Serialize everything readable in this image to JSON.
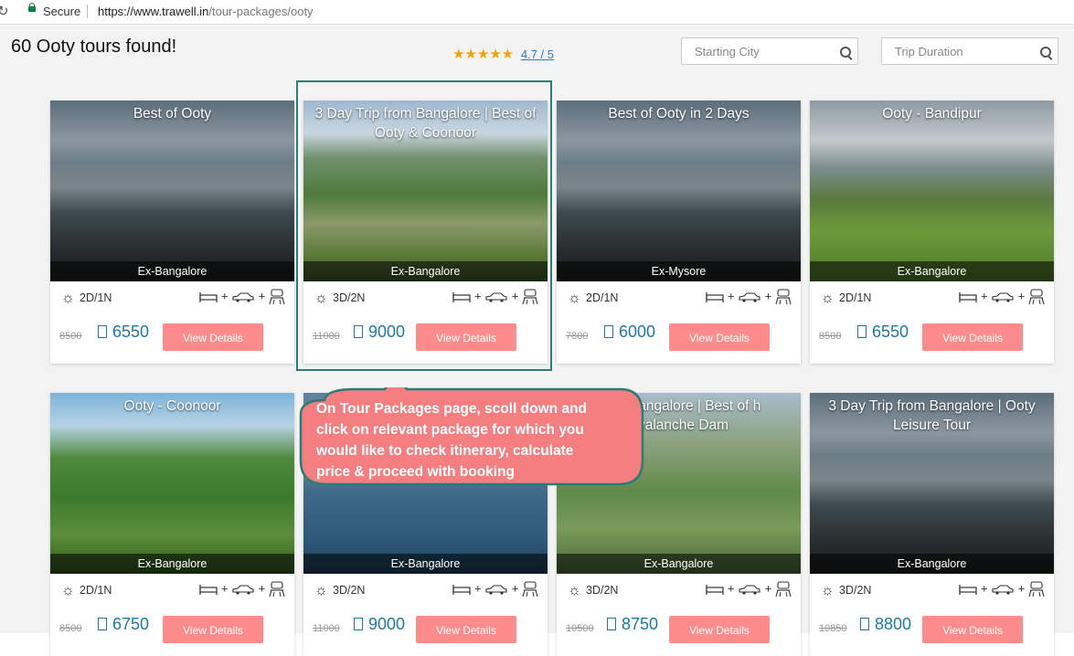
{
  "browser": {
    "secure_label": "Secure",
    "url_host": "https://www.trawell.in",
    "url_path": "/tour-packages/ooty"
  },
  "header": {
    "found_text": "60 Ooty tours found!",
    "stars": "★★★★★",
    "rating_link": "4.7 / 5",
    "starting_city_placeholder": "Starting City",
    "trip_duration_placeholder": "Trip Duration"
  },
  "colors": {
    "accent_button": "#ff8c8c",
    "price_blue": "#1a7aa2",
    "highlight_border": "#2e7b76",
    "callout_fill": "#f47e80"
  },
  "cards": [
    {
      "title": "Best of Ooty",
      "origin": "Ex-Bangalore",
      "duration": "2D/1N",
      "old_price": "8500",
      "price": "6550",
      "button": "View Details",
      "scene": "lake"
    },
    {
      "title": "3 Day Trip from Bangalore | Best of Ooty & Coonoor",
      "origin": "Ex-Bangalore",
      "duration": "3D/2N",
      "old_price": "11000",
      "price": "9000",
      "button": "View Details",
      "scene": "valley"
    },
    {
      "title": "Best of Ooty in 2 Days",
      "origin": "Ex-Mysore",
      "duration": "2D/1N",
      "old_price": "7800",
      "price": "6000",
      "button": "View Details",
      "scene": "lake"
    },
    {
      "title": "Ooty - Bandipur",
      "origin": "Ex-Bangalore",
      "duration": "2D/1N",
      "old_price": "8500",
      "price": "6550",
      "button": "View Details",
      "scene": "hills"
    },
    {
      "title": "Ooty - Coonoor",
      "origin": "Ex-Bangalore",
      "duration": "2D/1N",
      "old_price": "8500",
      "price": "6750",
      "button": "View Details",
      "scene": "green"
    },
    {
      "title": "",
      "origin": "Ex-Bangalore",
      "duration": "3D/2N",
      "old_price": "11000",
      "price": "9000",
      "button": "View Details",
      "scene": "water"
    },
    {
      "title": "from Bangalore | Best of h Avalanche Dam",
      "origin": "Ex-Bangalore",
      "duration": "3D/2N",
      "old_price": "10500",
      "price": "8750",
      "button": "View Details",
      "scene": "terrace"
    },
    {
      "title": "3 Day Trip from Bangalore | Ooty Leisure Tour",
      "origin": "Ex-Bangalore",
      "duration": "3D/2N",
      "old_price": "10850",
      "price": "8800",
      "button": "View Details",
      "scene": "lake"
    }
  ],
  "callout": {
    "lines": [
      "On Tour Packages page, scoll down and",
      "click on relevant package for which you",
      "would like to check itinerary, calculate",
      "price & proceed with booking"
    ]
  }
}
